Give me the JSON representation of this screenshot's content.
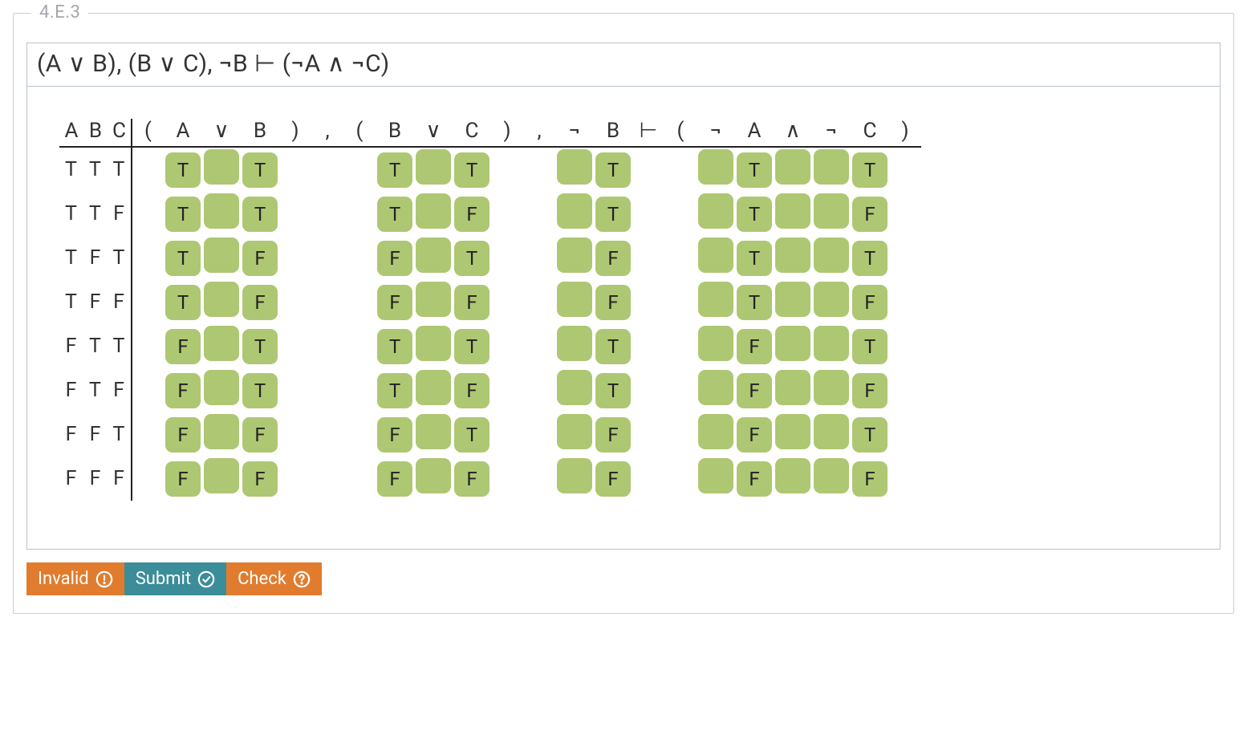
{
  "section_label": "4.E.3",
  "formula": "(A ∨ B), (B ∨ C), ¬B ⊢ (¬A ∧ ¬C)",
  "header": {
    "vars": [
      "A",
      "B",
      "C"
    ],
    "rhs_tokens": [
      "(",
      "A",
      "∨",
      "B",
      ")",
      ",",
      "(",
      "B",
      "∨",
      "C",
      ")",
      ",",
      "¬",
      "B",
      "⊢",
      "(",
      "¬",
      "A",
      "∧",
      "¬",
      "C",
      ")"
    ]
  },
  "cell_columns": [
    1,
    2,
    3,
    7,
    8,
    9,
    12,
    13,
    16,
    17,
    18,
    19,
    20
  ],
  "rows": [
    {
      "vars": [
        "T",
        "T",
        "T"
      ],
      "cells": {
        "1": "T",
        "2": "",
        "3": "T",
        "7": "T",
        "8": "",
        "9": "T",
        "12": "",
        "13": "T",
        "16": "",
        "17": "T",
        "18": "",
        "19": "",
        "20": "T"
      }
    },
    {
      "vars": [
        "T",
        "T",
        "F"
      ],
      "cells": {
        "1": "T",
        "2": "",
        "3": "T",
        "7": "T",
        "8": "",
        "9": "F",
        "12": "",
        "13": "T",
        "16": "",
        "17": "T",
        "18": "",
        "19": "",
        "20": "F"
      }
    },
    {
      "vars": [
        "T",
        "F",
        "T"
      ],
      "cells": {
        "1": "T",
        "2": "",
        "3": "F",
        "7": "F",
        "8": "",
        "9": "T",
        "12": "",
        "13": "F",
        "16": "",
        "17": "T",
        "18": "",
        "19": "",
        "20": "T"
      }
    },
    {
      "vars": [
        "T",
        "F",
        "F"
      ],
      "cells": {
        "1": "T",
        "2": "",
        "3": "F",
        "7": "F",
        "8": "",
        "9": "F",
        "12": "",
        "13": "F",
        "16": "",
        "17": "T",
        "18": "",
        "19": "",
        "20": "F"
      }
    },
    {
      "vars": [
        "F",
        "T",
        "T"
      ],
      "cells": {
        "1": "F",
        "2": "",
        "3": "T",
        "7": "T",
        "8": "",
        "9": "T",
        "12": "",
        "13": "T",
        "16": "",
        "17": "F",
        "18": "",
        "19": "",
        "20": "T"
      }
    },
    {
      "vars": [
        "F",
        "T",
        "F"
      ],
      "cells": {
        "1": "F",
        "2": "",
        "3": "T",
        "7": "T",
        "8": "",
        "9": "F",
        "12": "",
        "13": "T",
        "16": "",
        "17": "F",
        "18": "",
        "19": "",
        "20": "F"
      }
    },
    {
      "vars": [
        "F",
        "F",
        "T"
      ],
      "cells": {
        "1": "F",
        "2": "",
        "3": "F",
        "7": "F",
        "8": "",
        "9": "T",
        "12": "",
        "13": "F",
        "16": "",
        "17": "F",
        "18": "",
        "19": "",
        "20": "T"
      }
    },
    {
      "vars": [
        "F",
        "F",
        "F"
      ],
      "cells": {
        "1": "F",
        "2": "",
        "3": "F",
        "7": "F",
        "8": "",
        "9": "F",
        "12": "",
        "13": "F",
        "16": "",
        "17": "F",
        "18": "",
        "19": "",
        "20": "F"
      }
    }
  ],
  "buttons": {
    "invalid": "Invalid",
    "submit": "Submit",
    "check": "Check"
  }
}
